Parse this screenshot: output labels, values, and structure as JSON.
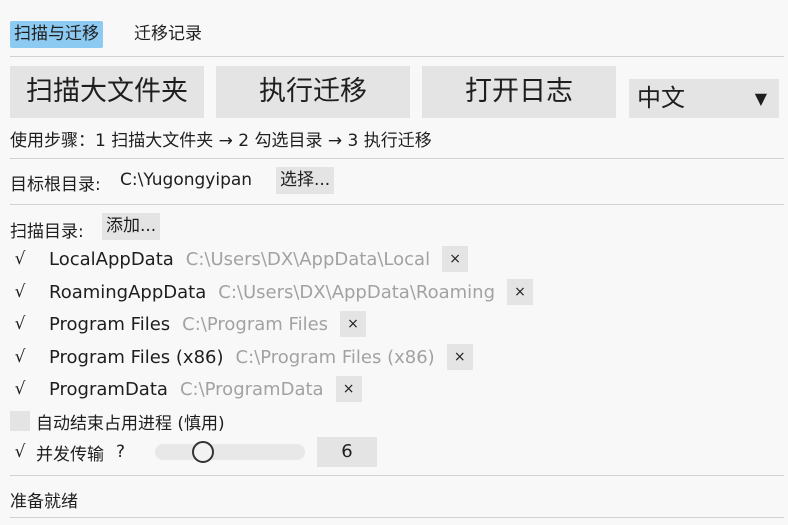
{
  "tabs": [
    {
      "label": "扫描与迁移",
      "active": true
    },
    {
      "label": "迁移记录",
      "active": false
    }
  ],
  "toolbar": {
    "scan_label": "扫描大文件夹",
    "migrate_label": "执行迁移",
    "log_label": "打开日志",
    "language": {
      "selected": "中文",
      "arrow_icon": "triangle-down-icon"
    }
  },
  "steps_text": "使用步骤：1 扫描大文件夹 → 2 勾选目录 → 3 执行迁移",
  "target": {
    "label": "目标根目录:",
    "value": "C:\\Yugongyipan",
    "choose_label": "选择..."
  },
  "scan": {
    "label": "扫描目录:",
    "add_label": "添加...",
    "remove_glyph": "×",
    "check_glyph": "√",
    "items": [
      {
        "name": "LocalAppData",
        "path": "C:\\Users\\DX\\AppData\\Local",
        "checked": true
      },
      {
        "name": "RoamingAppData",
        "path": "C:\\Users\\DX\\AppData\\Roaming",
        "checked": true
      },
      {
        "name": "Program Files",
        "path": "C:\\Program Files",
        "checked": true
      },
      {
        "name": "Program Files (x86)",
        "path": "C:\\Program Files (x86)",
        "checked": true
      },
      {
        "name": "ProgramData",
        "path": "C:\\ProgramData",
        "checked": true
      }
    ]
  },
  "options": {
    "auto_kill": {
      "label": "自动结束占用进程 (慎用)",
      "checked": false
    },
    "concurrent": {
      "label": "并发传输",
      "help": "?",
      "checked": true,
      "slider_fraction": 0.32,
      "value": "6"
    }
  },
  "status": "准备就绪"
}
